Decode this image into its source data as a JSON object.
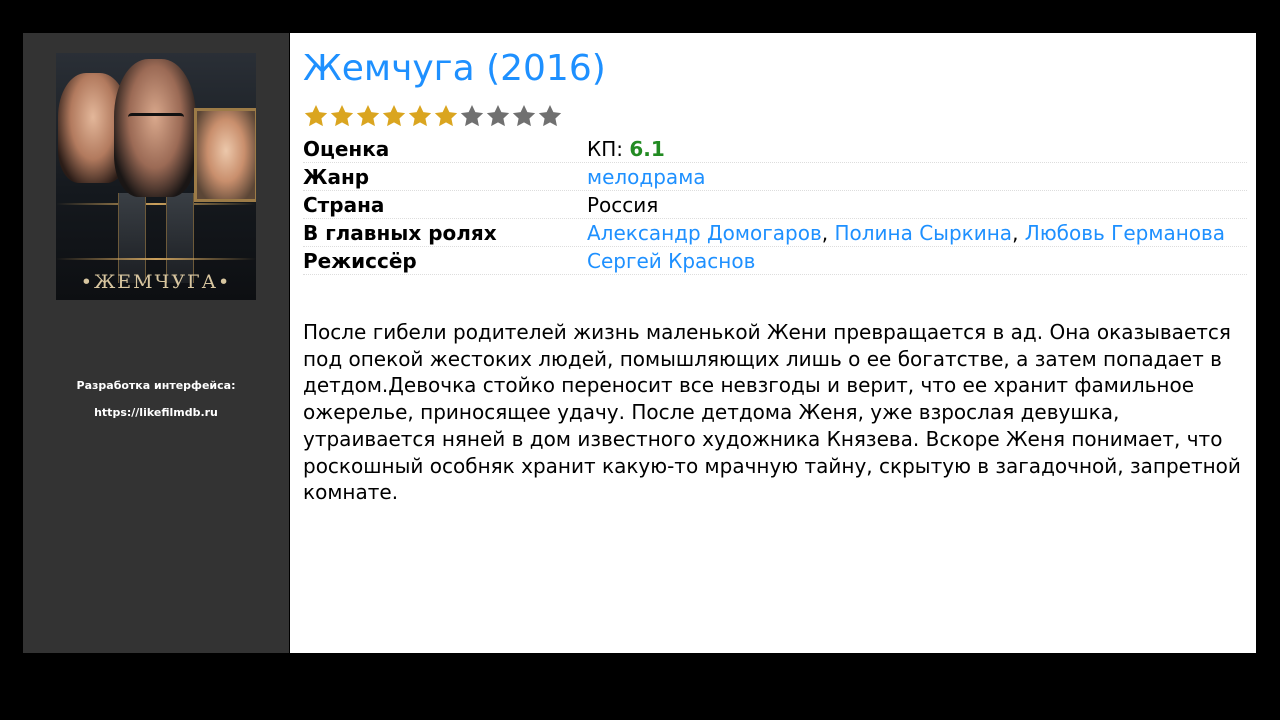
{
  "sidebar": {
    "poster_title": "•ЖЕМЧУГА•",
    "credit_line1": "Разработка интерфейса:",
    "credit_line2": "https://likefilmdb.ru"
  },
  "movie": {
    "title": "Жемчуга (2016)",
    "rating_stars": {
      "filled": 6,
      "total": 10
    },
    "colors": {
      "star_filled": "#daa520",
      "star_empty": "#707070",
      "link": "#1e90ff",
      "score": "#228b22"
    },
    "rows": {
      "rating_label": "Оценка",
      "rating_prefix": "КП: ",
      "rating_value": "6.1",
      "genre_label": "Жанр",
      "genre_value": "мелодрама",
      "country_label": "Страна",
      "country_value": "Россия",
      "cast_label": "В главных ролях",
      "cast": [
        "Александр Домогаров",
        "Полина Сыркина",
        "Любовь Германова"
      ],
      "cast_separator": ", ",
      "director_label": "Режиссёр",
      "director_value": "Сергей Краснов"
    },
    "description": "После гибели родителей жизнь маленькой Жени превращается в ад. Она оказывается под опекой жестоких людей, помышляющих лишь о ее богатстве, а затем попадает в детдом.Девочка стойко переносит все невзгоды и верит, что ее хранит фамильное ожерелье, приносящее удачу. После детдома Женя, уже взрослая девушка, утраивается няней в дом известного художника Князева. Вскоре Женя понимает, что роскошный особняк хранит какую-то мрачную тайну, скрытую в загадочной, запретной комнате."
  }
}
